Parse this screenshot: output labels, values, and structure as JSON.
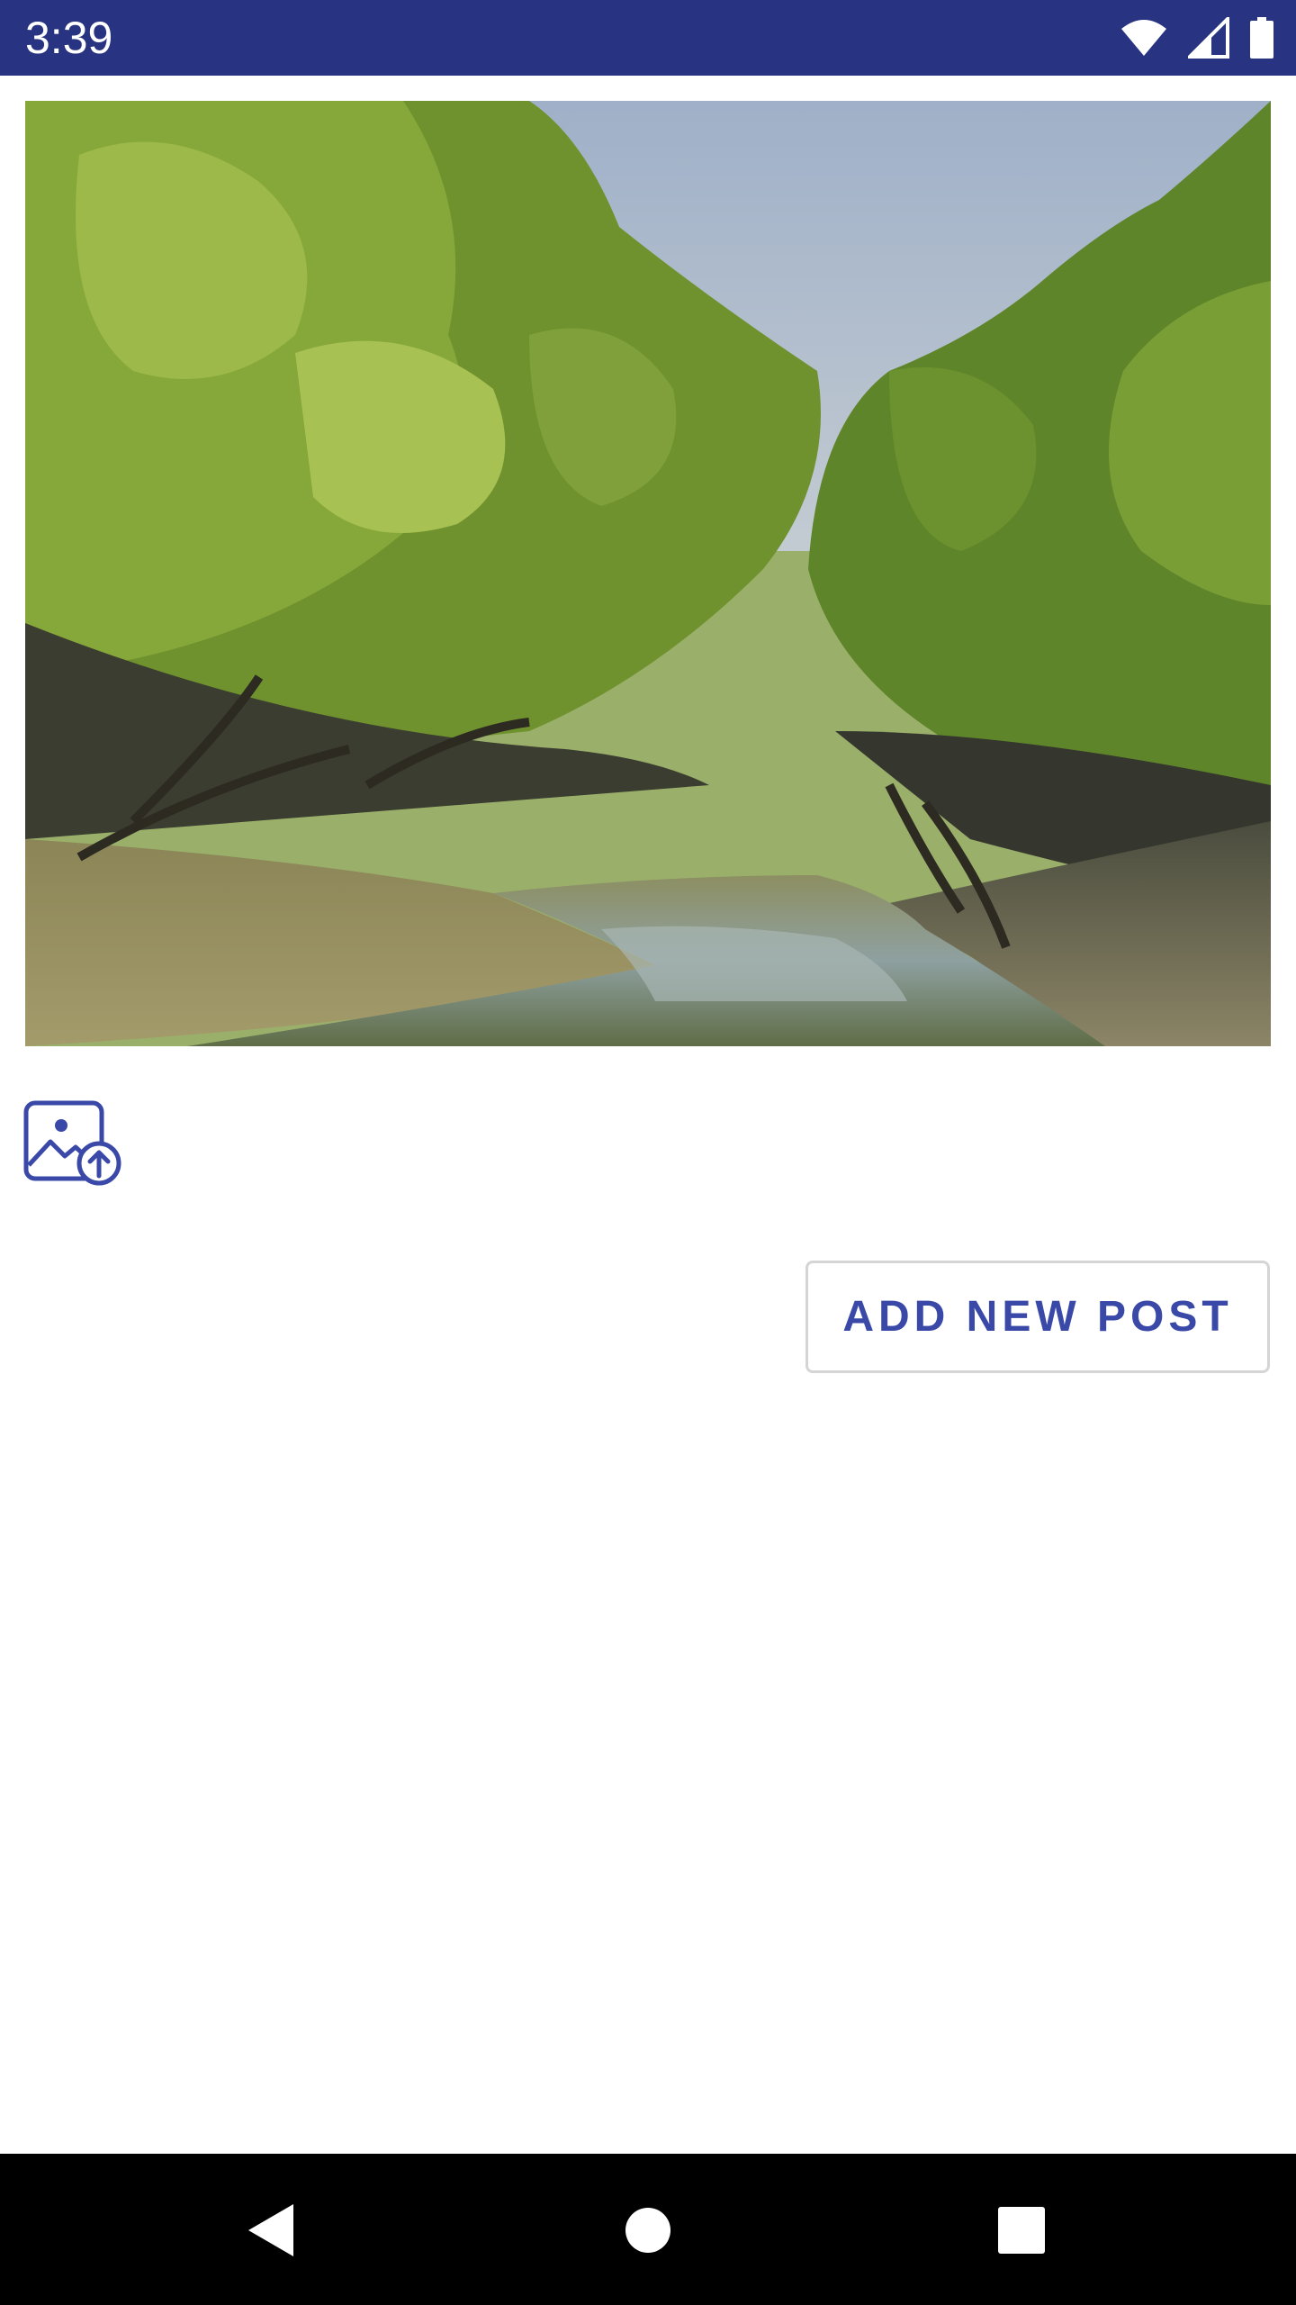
{
  "status_bar": {
    "time": "3:39",
    "background_color": "#283382",
    "icons": [
      "wifi-icon",
      "cellular-signal-icon",
      "battery-icon"
    ]
  },
  "post_image": {
    "description_icon": "photo"
  },
  "upload": {
    "icon": "image-upload-icon",
    "accent_color": "#3a49a8"
  },
  "actions": {
    "add_post_label": "ADD NEW POST"
  },
  "navigation_bar": {
    "icons": [
      "back-icon",
      "home-icon",
      "recents-icon"
    ]
  }
}
